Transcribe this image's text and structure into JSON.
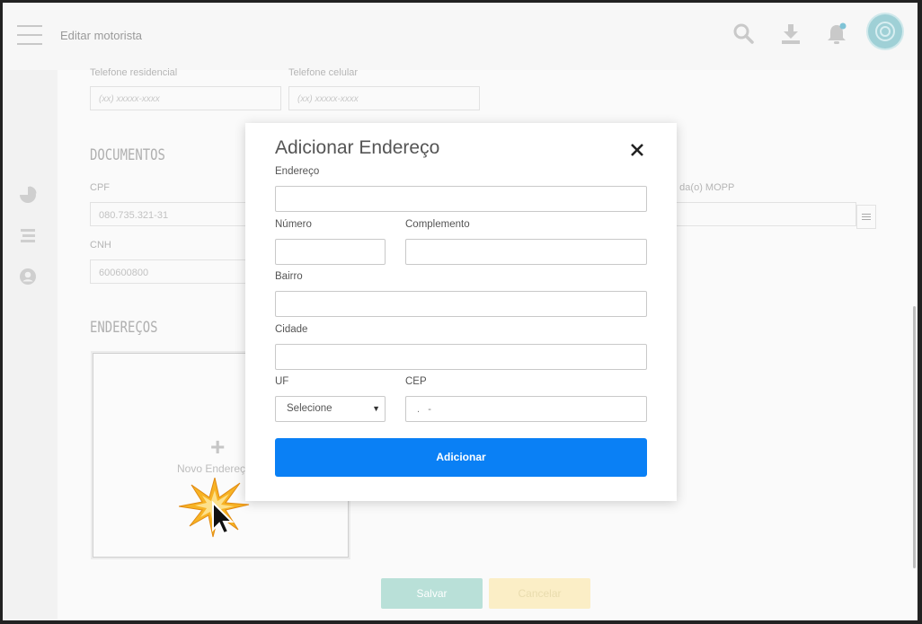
{
  "header": {
    "title": "Editar motorista"
  },
  "form": {
    "phone_home_label": "Telefone residencial",
    "phone_home_placeholder": "(xx) xxxxx-xxxx",
    "phone_cell_label": "Telefone celular",
    "phone_cell_placeholder": "(xx) xxxxx-xxxx",
    "documents_title": "DOCUMENTOS",
    "cpf_label": "CPF",
    "cpf_value": "080.735.321-31",
    "cnh_label": "CNH",
    "cnh_value": "600600800",
    "mopp_label_partial": "o da(o) MOPP",
    "addresses_title": "ENDEREÇOS",
    "new_address_plus": "+",
    "new_address_label": "Novo Endereço",
    "save_label": "Salvar",
    "cancel_label": "Cancelar"
  },
  "modal": {
    "title": "Adicionar Endereço",
    "close_glyph": "✕",
    "address_label": "Endereço",
    "number_label": "Número",
    "complement_label": "Complemento",
    "district_label": "Bairro",
    "city_label": "Cidade",
    "uf_label": "UF",
    "uf_selected": "Selecione",
    "cep_label": "CEP",
    "cep_mask": ".   -",
    "submit_label": "Adicionar"
  },
  "colors": {
    "primary": "#0a80f5",
    "save": "#b9e0d8",
    "cancel": "#fbeec6",
    "avatar": "#9fd0d6"
  },
  "icons": [
    "menu-icon",
    "search-icon",
    "download-icon",
    "bell-icon",
    "avatar-icon",
    "pie-chart-icon",
    "list-icon",
    "user-circle-icon",
    "calendar-icon",
    "plus-icon",
    "cursor-icon"
  ]
}
